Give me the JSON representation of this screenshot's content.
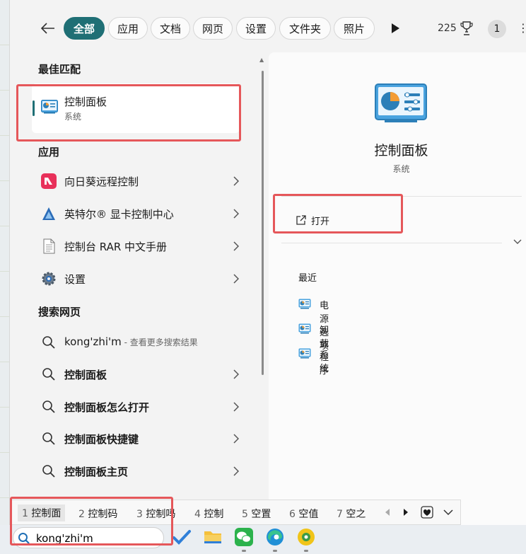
{
  "filters": {
    "items": [
      {
        "label": "全部",
        "active": true
      },
      {
        "label": "应用"
      },
      {
        "label": "文档"
      },
      {
        "label": "网页"
      },
      {
        "label": "设置"
      },
      {
        "label": "文件夹"
      },
      {
        "label": "照片"
      }
    ],
    "points": "225",
    "badge": "1"
  },
  "best_match": {
    "section": "最佳匹配",
    "title": "控制面板",
    "subtitle": "系统"
  },
  "apps": {
    "section": "应用",
    "items": [
      {
        "label": "向日葵远程控制",
        "icon": "sunlogin-icon"
      },
      {
        "label": "英特尔® 显卡控制中心",
        "icon": "intel-graphics-icon"
      },
      {
        "label": "控制台 RAR 中文手册",
        "icon": "document-icon"
      },
      {
        "label": "设置",
        "icon": "gear-icon"
      }
    ]
  },
  "web": {
    "section": "搜索网页",
    "items": [
      {
        "label": "kong'zhi'm",
        "sub": " - 查看更多搜索结果"
      },
      {
        "label": "控制面板"
      },
      {
        "label": "控制面板怎么打开"
      },
      {
        "label": "控制面板快捷键"
      },
      {
        "label": "控制面板主页"
      }
    ]
  },
  "preview": {
    "title": "控制面板",
    "subtitle": "系统",
    "open_label": "打开",
    "recent_title": "最近",
    "recent": [
      {
        "label": "电源选项"
      },
      {
        "label": "卸载程序"
      },
      {
        "label": "系统"
      }
    ]
  },
  "ime": {
    "candidates": [
      {
        "n": "1",
        "text": "控制面"
      },
      {
        "n": "2",
        "text": "控制码"
      },
      {
        "n": "3",
        "text": "控制吗"
      },
      {
        "n": "4",
        "text": "控制"
      },
      {
        "n": "5",
        "text": "空置"
      },
      {
        "n": "6",
        "text": "空值"
      },
      {
        "n": "7",
        "text": "空之"
      }
    ]
  },
  "taskbar": {
    "search_value": "kong'zhi'm"
  },
  "colors": {
    "accent": "#1f6f75",
    "highlight": "#e5575a"
  }
}
